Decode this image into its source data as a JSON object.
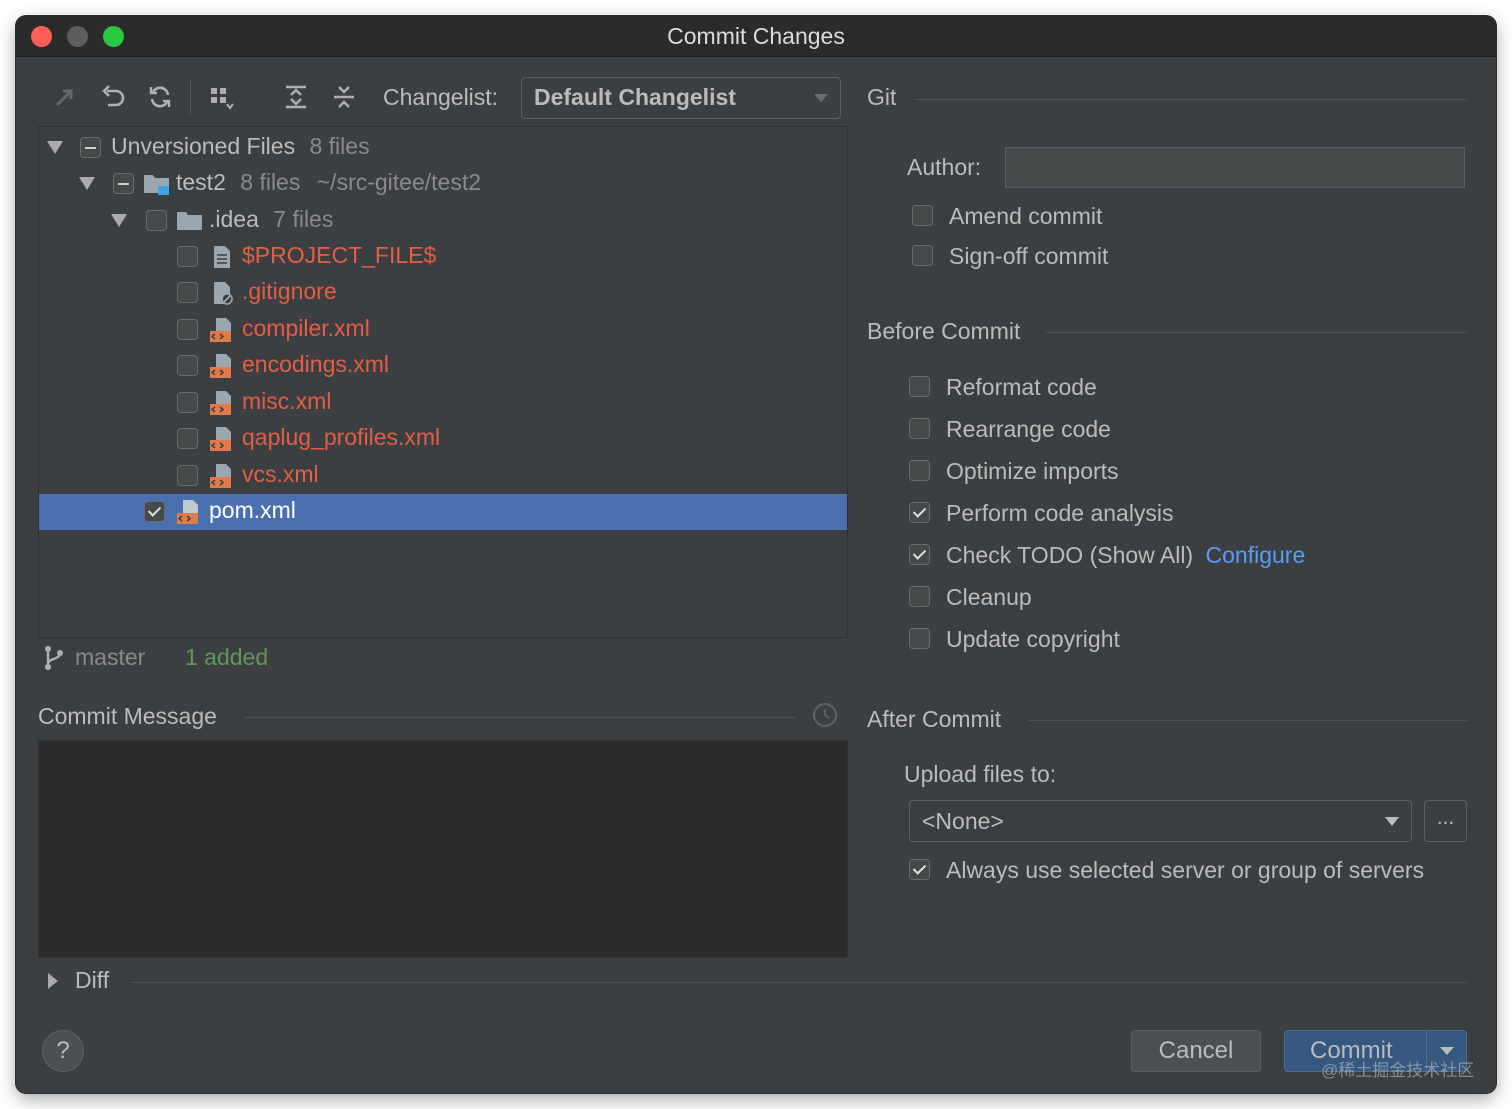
{
  "window": {
    "title": "Commit Changes"
  },
  "toolbar": {
    "changelist_label": "Changelist:",
    "changelist_value": "Default Changelist",
    "icons": [
      "move-to-changelist-icon",
      "rollback-icon",
      "refresh-icon",
      "group-by-icon",
      "expand-all-icon",
      "collapse-all-icon"
    ]
  },
  "tree": {
    "root": {
      "label": "Unversioned Files",
      "count": "8 files"
    },
    "module": {
      "label": "test2",
      "count": "8 files",
      "path": "~/src-gitee/test2"
    },
    "folder": {
      "label": ".idea",
      "count": "7 files"
    },
    "files": [
      {
        "name": "$PROJECT_FILE$",
        "checked": false
      },
      {
        "name": ".gitignore",
        "checked": false
      },
      {
        "name": "compiler.xml",
        "checked": false
      },
      {
        "name": "encodings.xml",
        "checked": false
      },
      {
        "name": "misc.xml",
        "checked": false
      },
      {
        "name": "qaplug_profiles.xml",
        "checked": false
      },
      {
        "name": "vcs.xml",
        "checked": false
      }
    ],
    "selected_file": {
      "name": "pom.xml",
      "checked": true
    }
  },
  "status": {
    "branch": "master",
    "added": "1 added"
  },
  "commit_message": {
    "label": "Commit Message",
    "value": ""
  },
  "diff": {
    "label": "Diff"
  },
  "git": {
    "title": "Git",
    "author_label": "Author:",
    "author_value": "",
    "amend_commit": {
      "label": "Amend commit",
      "checked": false
    },
    "signoff_commit": {
      "label": "Sign-off commit",
      "checked": false
    }
  },
  "before_commit": {
    "title": "Before Commit",
    "options": [
      {
        "label": "Reformat code",
        "checked": false
      },
      {
        "label": "Rearrange code",
        "checked": false
      },
      {
        "label": "Optimize imports",
        "checked": false
      },
      {
        "label": "Perform code analysis",
        "checked": true
      },
      {
        "label": "Check TODO (Show All)",
        "checked": true,
        "link": "Configure"
      },
      {
        "label": "Cleanup",
        "checked": false
      },
      {
        "label": "Update copyright",
        "checked": false
      }
    ]
  },
  "after_commit": {
    "title": "After Commit",
    "upload_label": "Upload files to:",
    "upload_value": "<None>",
    "browse_label": "...",
    "always_use": {
      "label": "Always use selected server or group of servers",
      "checked": true
    }
  },
  "buttons": {
    "help": "?",
    "cancel": "Cancel",
    "commit": "Commit"
  },
  "watermark": "@稀土掘金技术社区",
  "colors": {
    "background": "#3c3f41",
    "selection": "#4b6eaf",
    "unversioned": "#e45e43",
    "added": "#629755",
    "link": "#589df6",
    "primary_button": "#365880"
  }
}
